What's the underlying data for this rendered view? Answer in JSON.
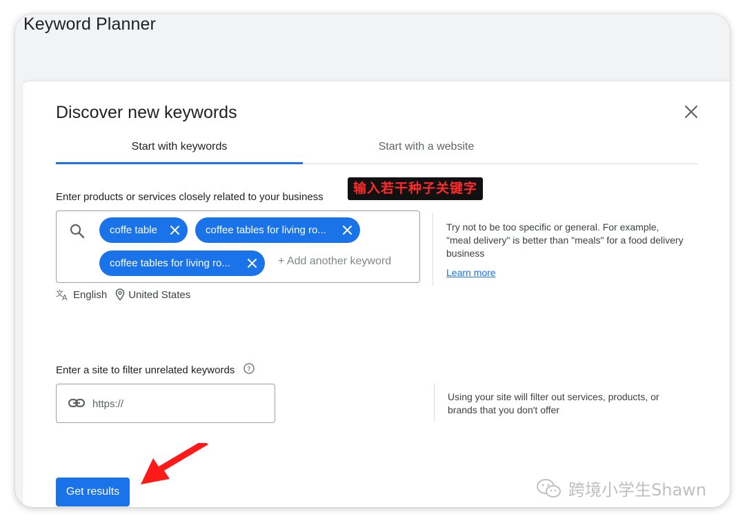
{
  "page": {
    "title": "Keyword Planner"
  },
  "dialog": {
    "title": "Discover new keywords",
    "tabs": [
      {
        "label": "Start with keywords",
        "active": true
      },
      {
        "label": "Start with a website",
        "active": false
      }
    ]
  },
  "keywords": {
    "label": "Enter products or services closely related to your business",
    "annotation": "输入若干种子关键字",
    "chips": [
      "coffe table",
      "coffee tables for living ro...",
      "coffee tables for living ro..."
    ],
    "add_placeholder": "+ Add another keyword",
    "language": "English",
    "location": "United States",
    "helper_text": "Try not to be too specific or general. For example, \"meal delivery\" is better than \"meals\" for a food delivery business",
    "learn_more": "Learn more"
  },
  "site_filter": {
    "label": "Enter a site to filter unrelated keywords",
    "placeholder": "https://",
    "helper_text": "Using your site will filter out services, products, or brands that you don't offer"
  },
  "actions": {
    "get_results": "Get results"
  },
  "watermark": {
    "text": "跨境小学生Shawn"
  },
  "colors": {
    "accent": "#1a73e8",
    "annotation_bg": "#111111",
    "annotation_text": "#ff2a2a",
    "arrow": "#ff1a1a"
  },
  "icons": [
    "search-icon",
    "close-icon",
    "chip-remove-icon",
    "translate-icon",
    "location-pin-icon",
    "help-icon",
    "link-icon",
    "red-arrow-icon",
    "wechat-icon"
  ]
}
